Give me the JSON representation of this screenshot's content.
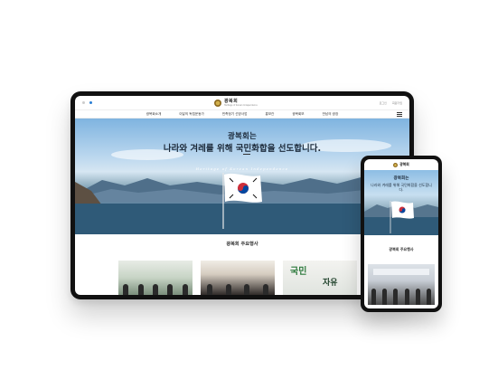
{
  "tablet": {
    "header": {
      "logo_title": "광복회",
      "logo_sub": "Heritage of Korean Independence",
      "util_login": "로그인",
      "util_join": "회원가입"
    },
    "nav": [
      {
        "label": "광복회소개"
      },
      {
        "label": "이달의 독립운동가"
      },
      {
        "label": "민족정기 선양사업"
      },
      {
        "label": "홍보관"
      },
      {
        "label": "광복회보"
      },
      {
        "label": "만남의 광장"
      }
    ],
    "hero": {
      "line1": "광복회는",
      "line2": "나라와 겨레를 위해 국민화합을 선도합니다.",
      "english": "Heritage of Korean Independence"
    },
    "section_title": "광복회 주요행사",
    "thumb_calligraphy": [
      "국민",
      "자유"
    ]
  },
  "phone": {
    "logo_title": "광복회",
    "hero_line1": "광복회는",
    "hero_line2": "나라와 겨레를 위해 국민화합을 선도합니다.",
    "section_title": "광복회 주요행사"
  }
}
